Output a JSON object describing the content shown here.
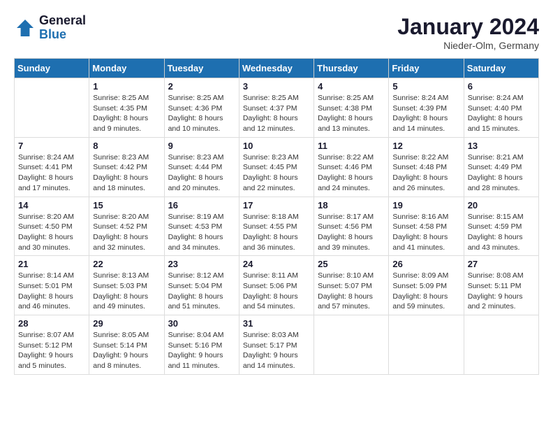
{
  "header": {
    "logo": {
      "general": "General",
      "blue": "Blue"
    },
    "title": "January 2024",
    "location": "Nieder-Olm, Germany"
  },
  "weekdays": [
    "Sunday",
    "Monday",
    "Tuesday",
    "Wednesday",
    "Thursday",
    "Friday",
    "Saturday"
  ],
  "weeks": [
    [
      {
        "day": "",
        "info": ""
      },
      {
        "day": "1",
        "info": "Sunrise: 8:25 AM\nSunset: 4:35 PM\nDaylight: 8 hours\nand 9 minutes."
      },
      {
        "day": "2",
        "info": "Sunrise: 8:25 AM\nSunset: 4:36 PM\nDaylight: 8 hours\nand 10 minutes."
      },
      {
        "day": "3",
        "info": "Sunrise: 8:25 AM\nSunset: 4:37 PM\nDaylight: 8 hours\nand 12 minutes."
      },
      {
        "day": "4",
        "info": "Sunrise: 8:25 AM\nSunset: 4:38 PM\nDaylight: 8 hours\nand 13 minutes."
      },
      {
        "day": "5",
        "info": "Sunrise: 8:24 AM\nSunset: 4:39 PM\nDaylight: 8 hours\nand 14 minutes."
      },
      {
        "day": "6",
        "info": "Sunrise: 8:24 AM\nSunset: 4:40 PM\nDaylight: 8 hours\nand 15 minutes."
      }
    ],
    [
      {
        "day": "7",
        "info": "Sunrise: 8:24 AM\nSunset: 4:41 PM\nDaylight: 8 hours\nand 17 minutes."
      },
      {
        "day": "8",
        "info": "Sunrise: 8:23 AM\nSunset: 4:42 PM\nDaylight: 8 hours\nand 18 minutes."
      },
      {
        "day": "9",
        "info": "Sunrise: 8:23 AM\nSunset: 4:44 PM\nDaylight: 8 hours\nand 20 minutes."
      },
      {
        "day": "10",
        "info": "Sunrise: 8:23 AM\nSunset: 4:45 PM\nDaylight: 8 hours\nand 22 minutes."
      },
      {
        "day": "11",
        "info": "Sunrise: 8:22 AM\nSunset: 4:46 PM\nDaylight: 8 hours\nand 24 minutes."
      },
      {
        "day": "12",
        "info": "Sunrise: 8:22 AM\nSunset: 4:48 PM\nDaylight: 8 hours\nand 26 minutes."
      },
      {
        "day": "13",
        "info": "Sunrise: 8:21 AM\nSunset: 4:49 PM\nDaylight: 8 hours\nand 28 minutes."
      }
    ],
    [
      {
        "day": "14",
        "info": "Sunrise: 8:20 AM\nSunset: 4:50 PM\nDaylight: 8 hours\nand 30 minutes."
      },
      {
        "day": "15",
        "info": "Sunrise: 8:20 AM\nSunset: 4:52 PM\nDaylight: 8 hours\nand 32 minutes."
      },
      {
        "day": "16",
        "info": "Sunrise: 8:19 AM\nSunset: 4:53 PM\nDaylight: 8 hours\nand 34 minutes."
      },
      {
        "day": "17",
        "info": "Sunrise: 8:18 AM\nSunset: 4:55 PM\nDaylight: 8 hours\nand 36 minutes."
      },
      {
        "day": "18",
        "info": "Sunrise: 8:17 AM\nSunset: 4:56 PM\nDaylight: 8 hours\nand 39 minutes."
      },
      {
        "day": "19",
        "info": "Sunrise: 8:16 AM\nSunset: 4:58 PM\nDaylight: 8 hours\nand 41 minutes."
      },
      {
        "day": "20",
        "info": "Sunrise: 8:15 AM\nSunset: 4:59 PM\nDaylight: 8 hours\nand 43 minutes."
      }
    ],
    [
      {
        "day": "21",
        "info": "Sunrise: 8:14 AM\nSunset: 5:01 PM\nDaylight: 8 hours\nand 46 minutes."
      },
      {
        "day": "22",
        "info": "Sunrise: 8:13 AM\nSunset: 5:03 PM\nDaylight: 8 hours\nand 49 minutes."
      },
      {
        "day": "23",
        "info": "Sunrise: 8:12 AM\nSunset: 5:04 PM\nDaylight: 8 hours\nand 51 minutes."
      },
      {
        "day": "24",
        "info": "Sunrise: 8:11 AM\nSunset: 5:06 PM\nDaylight: 8 hours\nand 54 minutes."
      },
      {
        "day": "25",
        "info": "Sunrise: 8:10 AM\nSunset: 5:07 PM\nDaylight: 8 hours\nand 57 minutes."
      },
      {
        "day": "26",
        "info": "Sunrise: 8:09 AM\nSunset: 5:09 PM\nDaylight: 8 hours\nand 59 minutes."
      },
      {
        "day": "27",
        "info": "Sunrise: 8:08 AM\nSunset: 5:11 PM\nDaylight: 9 hours\nand 2 minutes."
      }
    ],
    [
      {
        "day": "28",
        "info": "Sunrise: 8:07 AM\nSunset: 5:12 PM\nDaylight: 9 hours\nand 5 minutes."
      },
      {
        "day": "29",
        "info": "Sunrise: 8:05 AM\nSunset: 5:14 PM\nDaylight: 9 hours\nand 8 minutes."
      },
      {
        "day": "30",
        "info": "Sunrise: 8:04 AM\nSunset: 5:16 PM\nDaylight: 9 hours\nand 11 minutes."
      },
      {
        "day": "31",
        "info": "Sunrise: 8:03 AM\nSunset: 5:17 PM\nDaylight: 9 hours\nand 14 minutes."
      },
      {
        "day": "",
        "info": ""
      },
      {
        "day": "",
        "info": ""
      },
      {
        "day": "",
        "info": ""
      }
    ]
  ]
}
